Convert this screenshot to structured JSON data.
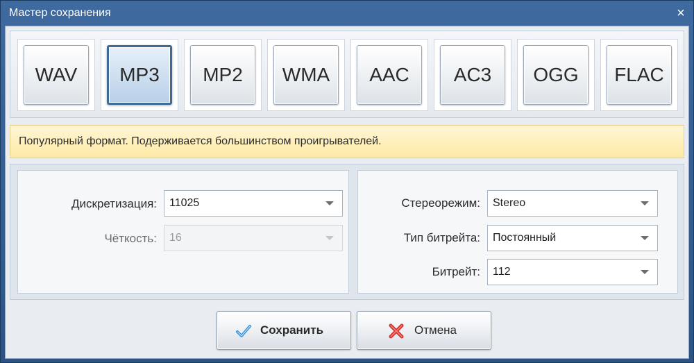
{
  "window": {
    "title": "Мастер сохранения",
    "close_glyph": "×"
  },
  "formats": [
    {
      "label": "WAV",
      "active": false
    },
    {
      "label": "MP3",
      "active": true
    },
    {
      "label": "MP2",
      "active": false
    },
    {
      "label": "WMA",
      "active": false
    },
    {
      "label": "AAC",
      "active": false
    },
    {
      "label": "AC3",
      "active": false
    },
    {
      "label": "OGG",
      "active": false
    },
    {
      "label": "FLAC",
      "active": false
    }
  ],
  "hint": "Популярный формат. Подерживается большинством проигрывателей.",
  "left_panel": {
    "sampling": {
      "label": "Дискретизация:",
      "value": "11025"
    },
    "clarity": {
      "label": "Чёткость:",
      "value": "16",
      "disabled": true
    }
  },
  "right_panel": {
    "stereo": {
      "label": "Стереорежим:",
      "value": "Stereo"
    },
    "bitrate_type": {
      "label": "Тип битрейта:",
      "value": "Постоянный"
    },
    "bitrate": {
      "label": "Битрейт:",
      "value": "112"
    }
  },
  "actions": {
    "save_label": "Сохранить",
    "cancel_label": "Отмена"
  },
  "colors": {
    "title_bar": "#2b5386",
    "active_format": "#3e6a96",
    "hint_bg": "#fde9a6",
    "save_check": "#3b8fd0",
    "cancel_cross": "#d8322c"
  },
  "icons": {
    "close": "close-icon",
    "save": "checkmark-icon",
    "cancel": "red-cross-icon",
    "dropdown": "chevron-down-icon"
  }
}
